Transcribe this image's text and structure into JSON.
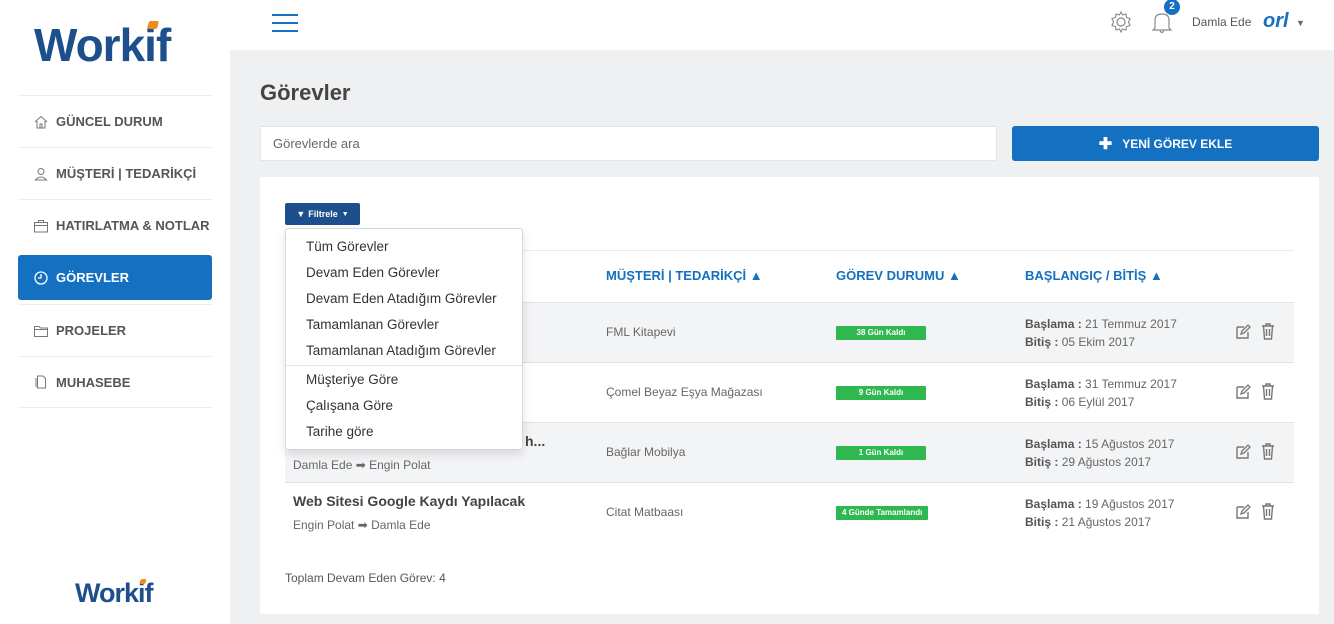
{
  "brand": {
    "name_prefix": "Work",
    "name_i": "i",
    "name_suffix": "f"
  },
  "sidebar": {
    "items": [
      {
        "label": "GÜNCEL DURUM",
        "icon": "home-icon"
      },
      {
        "label": "MÜŞTERİ | TEDARİKÇİ",
        "icon": "user-icon"
      },
      {
        "label": "HATIRLATMA & NOTLAR",
        "icon": "briefcase-icon"
      },
      {
        "label": "GÖREVLER",
        "icon": "clock-icon",
        "active": true
      },
      {
        "label": "PROJELER",
        "icon": "folder-icon"
      },
      {
        "label": "MUHASEBE",
        "icon": "document-icon"
      }
    ]
  },
  "topbar": {
    "notification_count": "2",
    "user_name": "Damla Ede",
    "company_logo_text": "orl"
  },
  "main": {
    "title": "Görevler",
    "search_placeholder": "Görevlerde ara",
    "add_button_label": "YENİ GÖREV EKLE",
    "filter_label": "Filtrele",
    "columns": {
      "customer": "MÜŞTERİ | TEDARİKÇİ ▲",
      "status": "GÖREV DURUMU ▲",
      "dates": "BAŞLANGIÇ / BİTİŞ ▲"
    },
    "start_label": "Başlama :",
    "end_label": "Bitiş :",
    "rows": [
      {
        "title": "",
        "from": "",
        "to": "",
        "customer": "FML Kitapevi",
        "status": "38 Gün Kaldı",
        "start": "21 Temmuz 2017",
        "end": "05 Ekim 2017"
      },
      {
        "title": "",
        "from": "",
        "to": "",
        "customer": "Çomel Beyaz Eşya Mağazası",
        "status": "9 Gün Kaldı",
        "start": "31 Temmuz 2017",
        "end": "06 Eylül 2017"
      },
      {
        "title": "h...",
        "from": "Damla Ede",
        "to": "Engin Polat",
        "customer": "Bağlar Mobilya",
        "status": "1 Gün Kaldı",
        "start": "15 Ağustos 2017",
        "end": "29 Ağustos 2017"
      },
      {
        "title": "Web Sitesi Google Kaydı Yapılacak",
        "from": "Engin Polat",
        "to": "Damla Ede",
        "customer": "Citat Matbaası",
        "status": "4 Günde Tamamlandı",
        "start": "19 Ağustos 2017",
        "end": "21 Ağustos 2017"
      }
    ],
    "total_label": "Toplam Devam Eden Görev: 4"
  },
  "dropdown": {
    "group1": [
      "Tüm Görevler",
      "Devam Eden Görevler",
      "Devam Eden Atadığım Görevler",
      "Tamamlanan Görevler",
      "Tamamlanan Atadığım Görevler"
    ],
    "group2": [
      "Müşteriye Göre",
      "Çalışana Göre",
      "Tarihe göre"
    ]
  },
  "colors": {
    "primary": "#1470c0",
    "brand_dark": "#1d4f8c",
    "accent": "#f08a1d",
    "status_green": "#2fb84f"
  }
}
